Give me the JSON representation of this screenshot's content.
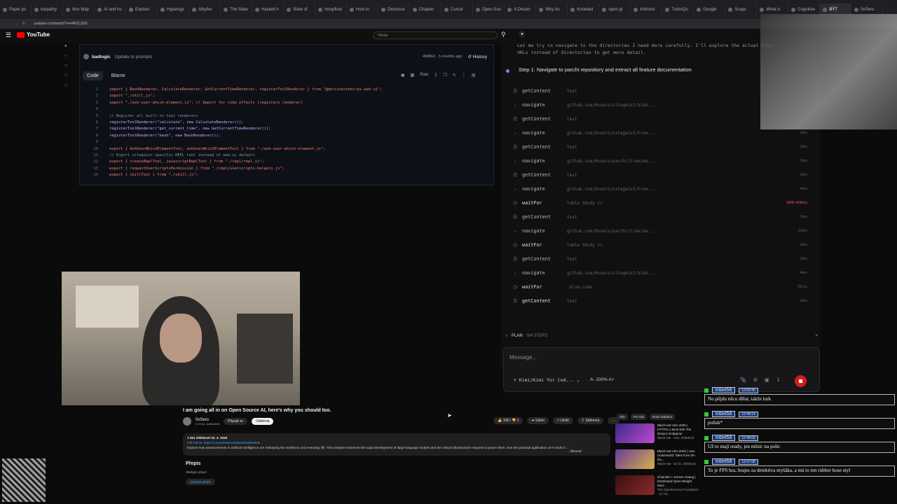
{
  "browser": {
    "tabs": [
      "Paper po",
      "karpathy",
      "Nov Map",
      "AI and hu",
      "Explore",
      "Hyperagr",
      "Albyfes",
      "The State",
      "Haskell h",
      "State of",
      "Hoopflow",
      "How to",
      "Democra",
      "Chapter",
      "Cursor",
      "Open-Sou",
      "A Dream",
      "Why do",
      "Knowled",
      "open-gl",
      "Inferenc",
      "TurboQu",
      "Google",
      "Scaps",
      "What is",
      "Cognitive",
      "BÝT",
      "0xSero"
    ],
    "active_tab_index": 26,
    "url": "youtube.com/watch?v=e4R3C3G0"
  },
  "youtube": {
    "logo": "YouTube",
    "search_placeholder": "Hledat",
    "video_title": "I am going all in on Open Source AI, here's why you should too.",
    "channel": "0xSero",
    "subscribers": "3,78 tis. odběratelů",
    "join_label": "Připojit se",
    "subscribe_label": "Odebírat",
    "likes": "108",
    "dislikes": "1",
    "share_label": "Sdílet",
    "save_label": "Uložit",
    "download_label": "Stáhnout",
    "views_date": "1 051 zhlédnutí  23. 3. 2026",
    "full_article": "Full Article: https://x.com/0xSero/status/203593208...",
    "description": "Explore how advancements in artificial intelligence are reshaping the workforce and everyday life. This analysis examines the rapid development of large language models and the critical infrastructure required to power them. See the practical application of AI tools in...",
    "more_label": "...Škrnout",
    "transcript_heading": "Přepis",
    "transcript_sub": "Sledujte přepis",
    "transcript_button": "Zobrazit přepis",
    "chips": [
      "Vše",
      "Pro vás",
      "Nově nahráno"
    ],
    "suggestions": [
      {
        "title": "Black Hat USA 2025 | HTTP/1.1 Must Die! The Desync Endgame",
        "meta": "Black Hat · 3 tis. zhlédnutí"
      },
      {
        "title": "Black Hat USA 2025 | Unix Underworld: Tales from the Da...",
        "meta": "Black Hat · 52 tis. zhlédnutí"
      },
      {
        "title": "Chainath × Jensen Huang | Distributed Open-Weight Mod...",
        "meta": "The Openference Foundation · 3,7 tis."
      }
    ]
  },
  "github": {
    "author": "badlogic",
    "commit_msg": "Update to prompts",
    "commit_meta": "408ffe0 · 5 months ago",
    "history_label": "History",
    "tab_code": "Code",
    "tab_blame": "Blame",
    "raw_label": "Raw",
    "lines": [
      {
        "n": "1",
        "t": "import { BashRenderer, CalculateRenderer, GetCurrentTimeRenderer, registerToolRenderer } from \"@mariozechner/pi-web-ui\";"
      },
      {
        "n": "2",
        "t": "import \"./skill.js\";"
      },
      {
        "n": "3",
        "t": "import \"./ask-user-which-element.js\"; // Import for side effects (registers renderer)"
      },
      {
        "n": "4",
        "t": ""
      },
      {
        "n": "5",
        "t": "// Register all built-in tool renderers"
      },
      {
        "n": "6",
        "t": "registerToolRenderer(\"calculate\", new CalculateRenderer());"
      },
      {
        "n": "7",
        "t": "registerToolRenderer(\"get_current_time\", new GetCurrentTimeRenderer());"
      },
      {
        "n": "8",
        "t": "registerToolRenderer(\"bash\", new BashRenderer());"
      },
      {
        "n": "9",
        "t": ""
      },
      {
        "n": "10",
        "t": "export { AskUserWhichElementTool, askUserWhichElementTool } from \"./ask-user-which-element.js\";"
      },
      {
        "n": "11",
        "t": "// Export sitegeist-specific REPL tool instead of web-ui default"
      },
      {
        "n": "12",
        "t": "export { createReplTool, javascriptReplTool } from \"./repl/repl.js\";"
      },
      {
        "n": "13",
        "t": "export { requestUserScriptsPermission } from \"./repl/userscripts-helpers.js\";"
      },
      {
        "n": "14",
        "t": "export { skillTool } from \"./skill.js\";"
      }
    ]
  },
  "agent": {
    "intro": "Let me try to navigate to the directories I need more carefully. I'll explore the actual file URLs instead of directories to get more detail.",
    "step_title": "Step 1: Navigate to parchi repository and extract all feature documentation",
    "actions": [
      {
        "act": "getContent",
        "arg": "text",
        "time": ""
      },
      {
        "act": "navigate",
        "arg": "github.com/0xsero/sitegeist/blob...",
        "time": ""
      },
      {
        "act": "getContent",
        "arg": "text",
        "time": ""
      },
      {
        "act": "navigate",
        "arg": "github.com/0xsero/sitegeist/tree...",
        "time": "2ms"
      },
      {
        "act": "getContent",
        "arg": "text",
        "time": "1ms"
      },
      {
        "act": "navigate",
        "arg": "github.com/0xsero/parchi/tree/ma...",
        "time": "2ms"
      },
      {
        "act": "getContent",
        "arg": "text",
        "time": "2ms"
      },
      {
        "act": "navigate",
        "arg": "github.com/0xsero/sitegeist/tree...",
        "time": "4ms"
      },
      {
        "act": "waitFor",
        "arg": "table tbody tr",
        "time": "ERR 458ms"
      },
      {
        "act": "getContent",
        "arg": "text",
        "time": "1ms"
      },
      {
        "act": "navigate",
        "arg": "github.com/0xsero/parchi/tree/ma...",
        "time": "32ms"
      },
      {
        "act": "waitFor",
        "arg": "table tbody tr",
        "time": "2ms"
      },
      {
        "act": "getContent",
        "arg": "text",
        "time": "1ms"
      },
      {
        "act": "navigate",
        "arg": "github.com/0xsero/sitegeist/blob...",
        "time": "4ms"
      },
      {
        "act": "waitFor",
        "arg": ".blob-code",
        "time": "50.1s"
      },
      {
        "act": "getContent",
        "arg": "text",
        "time": "2ms"
      }
    ],
    "plan_label": "PLAN",
    "plan_steps": "0/4 STEPS",
    "message_placeholder": "Message...",
    "model": "Kimi/Kimi for Cod...",
    "zoom": "A- 100% A+"
  },
  "chat": [
    {
      "user": "tribet58",
      "time": "12:50:45",
      "msg": "No půjdu něco dělat, takže lurk"
    },
    {
      "user": "tribet58",
      "time": "12:48:14",
      "msg": "polish*"
    },
    {
      "user": "tribet58",
      "time": "12:48:03",
      "msg": "Už to mají ready, jen měsíc na polic"
    },
    {
      "user": "tribet58",
      "time": "12:47:58",
      "msg": "To je FPS hra, hrajes za detektiva myšáka, a má to ten rubber hose styl"
    }
  ],
  "colors": {
    "accent_red": "#ff0000",
    "stop_button": "#d11d1d",
    "chat_badge": "#1b3a7a",
    "err": "#e5534b"
  }
}
